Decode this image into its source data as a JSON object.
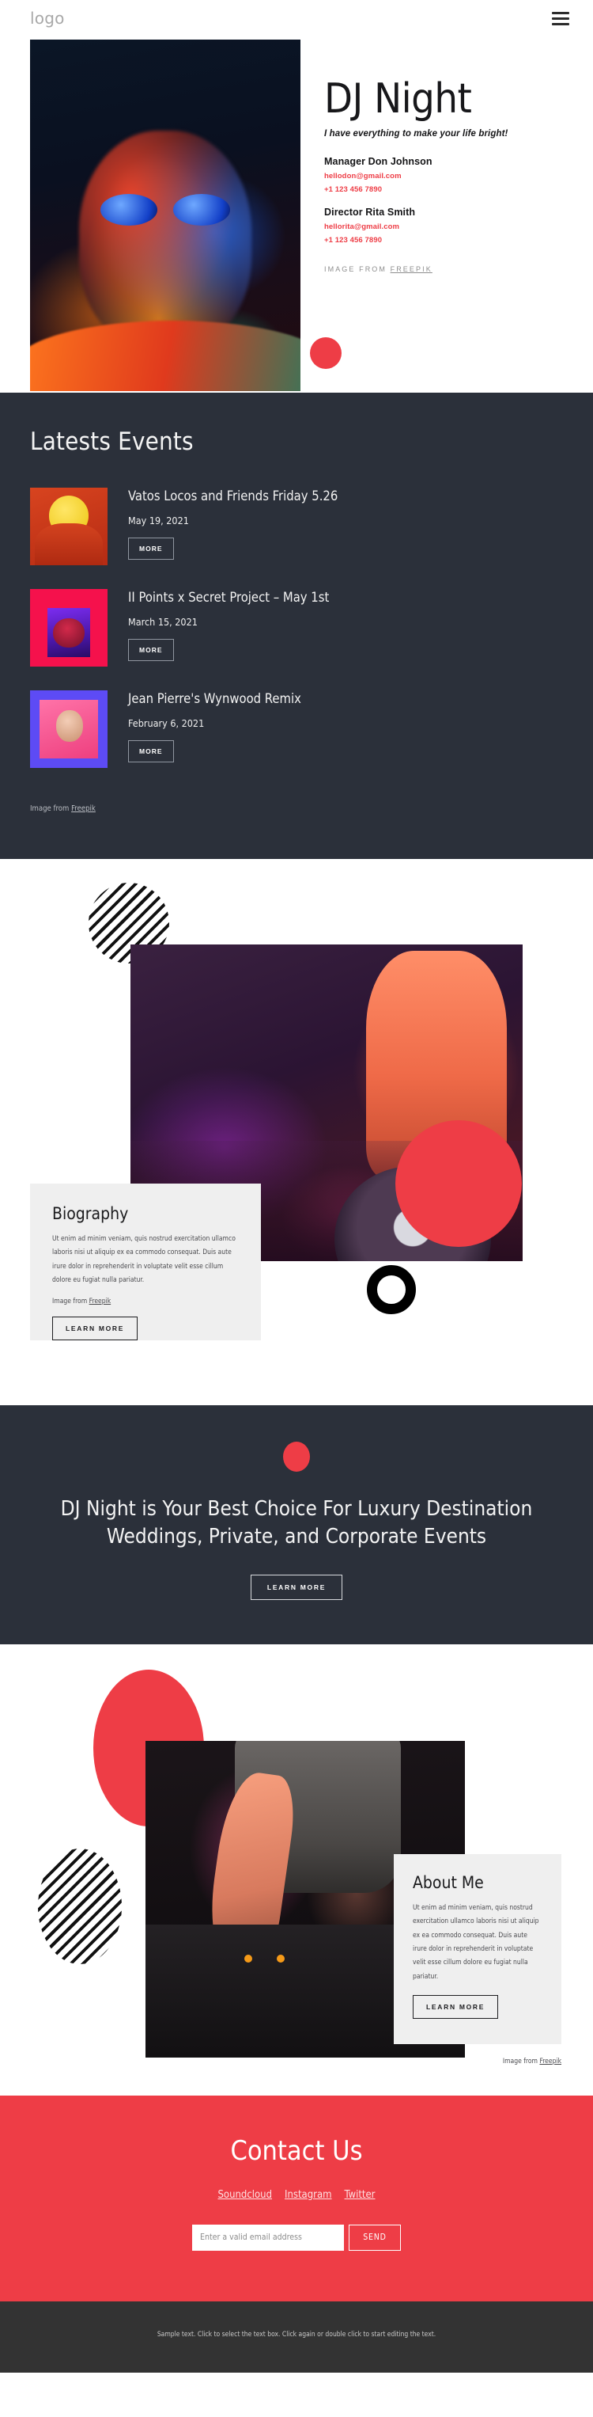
{
  "header": {
    "logo": "logo",
    "menu_icon": "hamburger-icon"
  },
  "hero": {
    "title": "DJ Night",
    "tagline": "I have everything to make your life bright!",
    "contacts": [
      {
        "name": "Manager Don Johnson",
        "email": "hellodon@gmail.com",
        "phone": "+1 123 456 7890"
      },
      {
        "name": "Director Rita Smith",
        "email": "hellorita@gmail.com",
        "phone": "+1 123 456 7890"
      }
    ],
    "credit_prefix": "IMAGE FROM ",
    "credit_link": "FREEPIK"
  },
  "events": {
    "title": "Latests Events",
    "more_label": "MORE",
    "items": [
      {
        "name": "Vatos Locos and Friends Friday 5.26",
        "date": "May 19, 2021"
      },
      {
        "name": "II Points x Secret Project – May 1st",
        "date": "March 15, 2021"
      },
      {
        "name": "Jean Pierre's Wynwood Remix",
        "date": "February 6, 2021"
      }
    ],
    "credit_prefix": "Image from ",
    "credit_link": "Freepik"
  },
  "biography": {
    "heading": "Biography",
    "body": "Ut enim ad minim veniam, quis nostrud exercitation ullamco laboris nisi ut aliquip ex ea commodo consequat. Duis aute irure dolor in reprehenderit in voluptate velit esse cillum dolore eu fugiat nulla pariatur.",
    "credit_prefix": "Image from ",
    "credit_link": "Freepik",
    "button_label": "LEARN MORE"
  },
  "cta": {
    "heading": "DJ Night is Your Best Choice For Luxury Destination Weddings, Private, and Corporate Events",
    "button_label": "LEARN MORE"
  },
  "about": {
    "heading": "About Me",
    "body": "Ut enim ad minim veniam, quis nostrud exercitation ullamco laboris nisi ut aliquip ex ea commodo consequat. Duis aute irure dolor in reprehenderit in voluptate velit esse cillum dolore eu fugiat nulla pariatur.",
    "button_label": "LEARN MORE",
    "credit_prefix": "Image from ",
    "credit_link": "Freepik"
  },
  "contact": {
    "heading": "Contact Us",
    "social": [
      {
        "label": "Soundcloud"
      },
      {
        "label": "Instagram"
      },
      {
        "label": "Twitter"
      }
    ],
    "email_placeholder": "Enter a valid email address",
    "email_value": "",
    "send_label": "SEND"
  },
  "footer": {
    "text": "Sample text. Click to select the text box. Click again or double click to start editing the text."
  },
  "colors": {
    "accent_red": "#ee3d46",
    "dark_panel": "#2b303a",
    "footer_dark": "#333333",
    "card_grey": "#efefef"
  }
}
